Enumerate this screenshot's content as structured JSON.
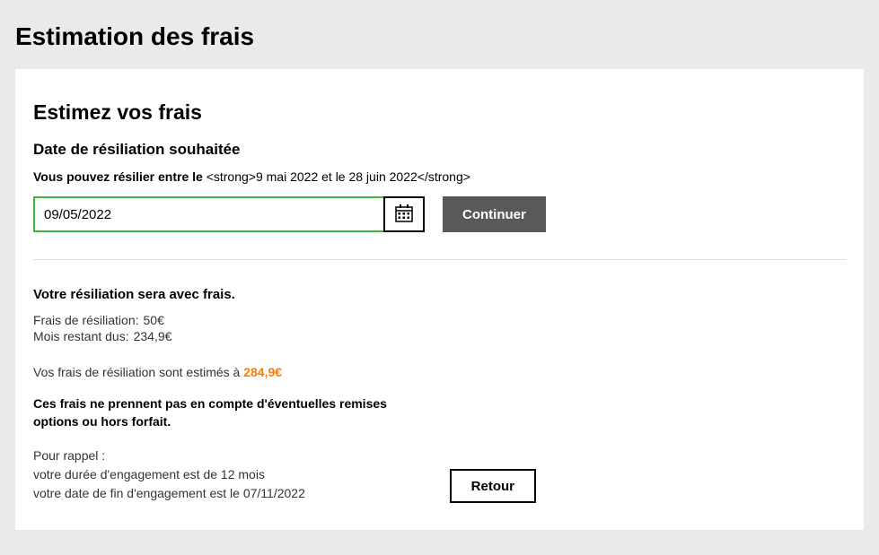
{
  "page": {
    "title": "Estimation des frais"
  },
  "card": {
    "title": "Estimez vos frais",
    "dateSection": {
      "label": "Date de résiliation souhaitée",
      "rangePrefix": "Vous pouvez résilier entre le ",
      "rangeRaw": "<strong>9 mai 2022 et le 28 juin 2022</strong>",
      "inputValue": "09/05/2022",
      "continueLabel": "Continuer"
    },
    "result": {
      "heading": "Votre résiliation sera avec frais.",
      "breakdown": [
        {
          "label": "Frais de résiliation:",
          "value": "50€"
        },
        {
          "label": "Mois restant dus:",
          "value": "234,9€"
        }
      ],
      "estimatePrefix": "Vos frais de résiliation sont estimés à ",
      "estimateAmount": "284,9€",
      "disclaimer": "Ces frais ne prennent pas en compte d'éventuelles remises options ou hors forfait.",
      "reminder": {
        "intro": "Pour rappel :",
        "line1": "votre durée d'engagement est de 12 mois",
        "line2": "votre date de fin d'engagement est le 07/11/2022"
      },
      "returnLabel": "Retour"
    }
  }
}
